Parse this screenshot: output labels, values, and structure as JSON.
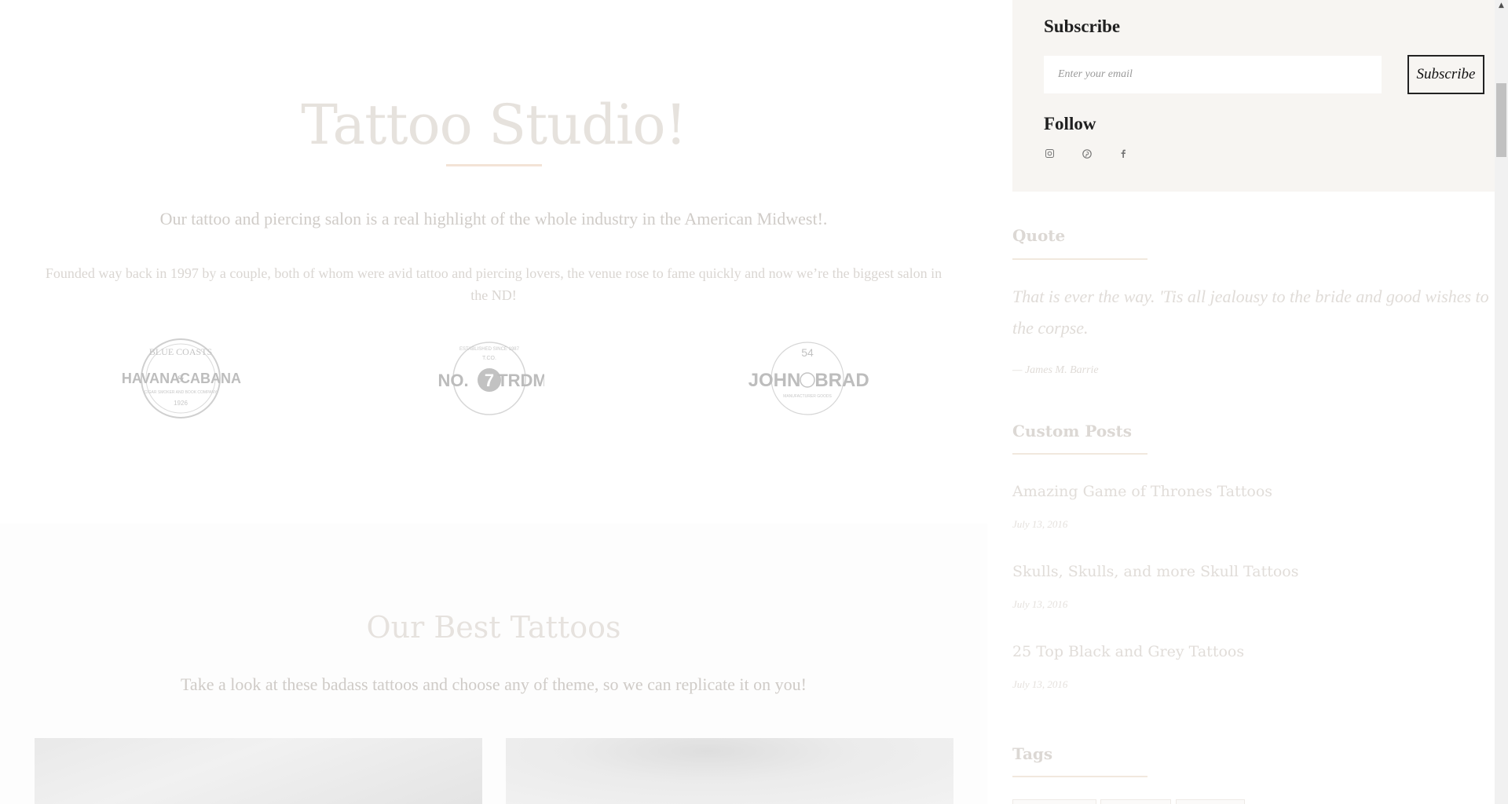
{
  "hero": {
    "title": "Tattoo Studio!",
    "lead": "Our tattoo and piercing salon is a real highlight of the whole industry in the American Midwest!.",
    "body": "Founded way back in 1997 by a couple, both of whom were avid tattoo and piercing lovers, the venue rose to fame quickly and now we’re the biggest salon in the ND!"
  },
  "logos": [
    {
      "top": "BLUE COASTS",
      "left": "HAVANA",
      "amp": "&",
      "right": "CABANA",
      "bottom": "CIGAR SMOKER AND BOOK COMPANY",
      "year": "1926",
      "icon": "havana-cabana-logo"
    },
    {
      "top": "ESTABLISHED SINCE 1987",
      "left": "NO.",
      "mid": "7",
      "right": "TRDM",
      "sub": "T.CO.",
      "icon": "no7-trdm-logo"
    },
    {
      "top": "54",
      "left": "JOHN",
      "right": "BRAD",
      "bottom": "MANUFACTURER GOODS",
      "icon": "john-brad-logo"
    }
  ],
  "best": {
    "title": "Our Best Tattoos",
    "subtitle": "Take a look at these badass tattoos and choose any of theme, so we can replicate it on you!"
  },
  "sidebar": {
    "subscribe": {
      "heading": "Subscribe",
      "placeholder": "Enter your email",
      "button": "Subscribe"
    },
    "follow": {
      "heading": "Follow",
      "icons": [
        "instagram-icon",
        "pinterest-icon",
        "facebook-icon"
      ]
    },
    "quote": {
      "heading": "Quote",
      "text": "That is ever the way. 'Tis all jealousy to the bride and good wishes to the corpse.",
      "author": "— James M. Barrie"
    },
    "custom_posts": {
      "heading": "Custom Posts",
      "items": [
        {
          "title": "Amazing Game of Thrones Tattoos",
          "date": "July 13, 2016"
        },
        {
          "title": "Skulls, Skulls, and more Skull Tattoos",
          "date": "July 13, 2016"
        },
        {
          "title": "25 Top Black and Grey Tattoos",
          "date": "July 13, 2016"
        }
      ]
    },
    "tags": {
      "heading": "Tags"
    }
  },
  "colors": {
    "accent_line": "#f1e8de",
    "subscribe_bg": "#f7f5f2",
    "faded_text": "#e0dcd8"
  }
}
